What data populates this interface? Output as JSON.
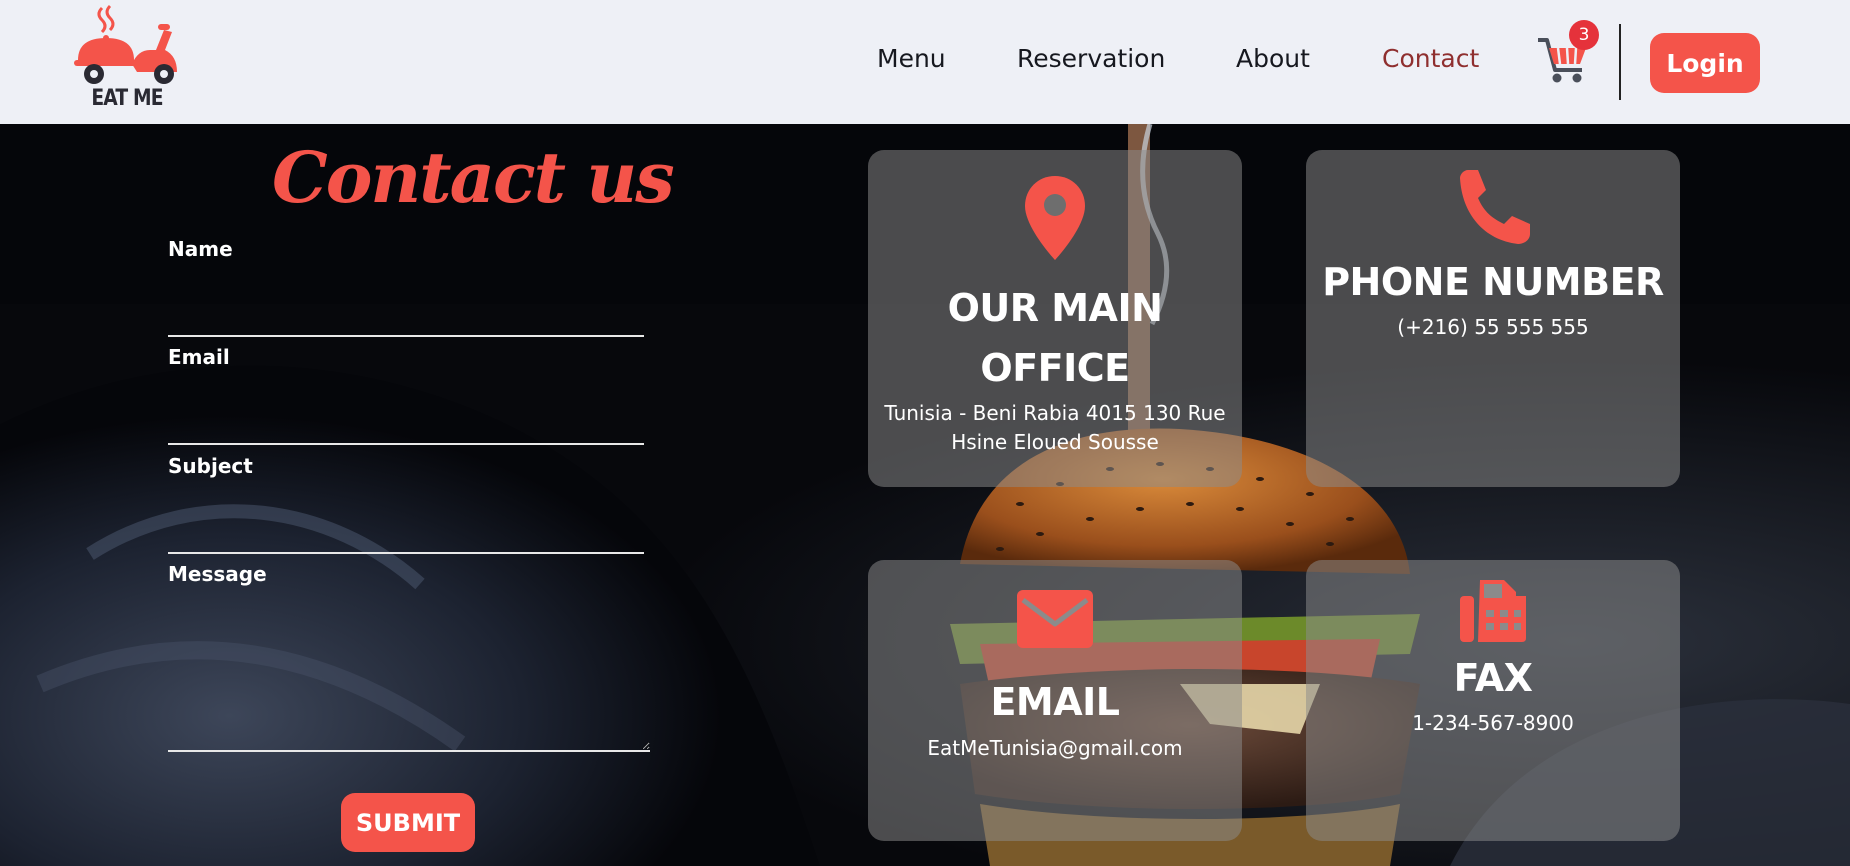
{
  "brand": {
    "name": "EAT ME",
    "logo_icon": "delivery-scooter-icon"
  },
  "nav": {
    "items": [
      {
        "label": "Menu",
        "active": false
      },
      {
        "label": "Reservation",
        "active": false
      },
      {
        "label": "About",
        "active": false
      },
      {
        "label": "Contact",
        "active": true
      }
    ],
    "cart": {
      "icon": "cart-icon",
      "count": "3"
    },
    "login_label": "Login"
  },
  "contact_form": {
    "title": "Contact us",
    "fields": {
      "name": {
        "label": "Name",
        "value": ""
      },
      "email": {
        "label": "Email",
        "value": ""
      },
      "subject": {
        "label": "Subject",
        "value": ""
      },
      "message": {
        "label": "Message",
        "value": ""
      }
    },
    "submit_label": "SUBMIT"
  },
  "cards": {
    "office": {
      "icon": "map-pin-icon",
      "title_line1": "OUR MAIN",
      "title_line2": "OFFICE",
      "text_line1": "Tunisia - Beni Rabia 4015 130 Rue",
      "text_line2": "Hsine Eloued Sousse"
    },
    "phone": {
      "icon": "phone-icon",
      "title": "PHONE NUMBER",
      "text": "(+216) 55 555 555"
    },
    "email": {
      "icon": "envelope-icon",
      "title": "EMAIL",
      "text": "EatMeTunisia@gmail.com"
    },
    "fax": {
      "icon": "fax-icon",
      "title": "FAX",
      "text": "1-234-567-8900"
    }
  },
  "colors": {
    "accent": "#f4544a",
    "header_bg": "#eef0f6",
    "active_nav": "#8f2f2f",
    "badge": "#e5323b",
    "card_bg": "rgba(140,140,140,0.52)"
  }
}
